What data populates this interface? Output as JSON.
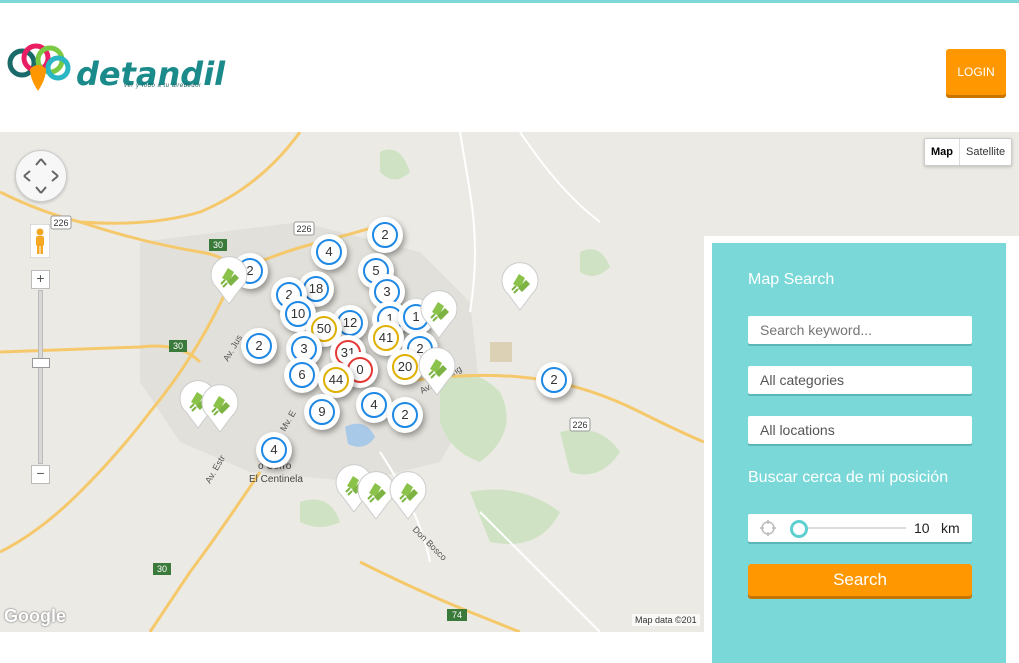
{
  "header": {
    "logo_word": "detandil",
    "logo_tagline": "ver y todo a tu alrededor",
    "login_label": "LOGIN"
  },
  "map": {
    "type_map_label": "Map",
    "type_satellite_label": "Satellite",
    "zoom_in_label": "+",
    "zoom_out_label": "−",
    "attribution_logo": "Google",
    "attribution_text": "Map data ©201",
    "road_labels": [
      "226",
      "226",
      "30",
      "30",
      "30",
      "226",
      "74"
    ],
    "street_labels": [
      "Av. Jus",
      "Av. Estr",
      "Av. Fleming",
      "Don Bosco",
      "Mv. E",
      "o Cerro",
      "El Centinela"
    ],
    "clusters": [
      "2",
      "4",
      "2",
      "5",
      "18",
      "2",
      "3",
      "10",
      "12",
      "1",
      "1",
      "50",
      "41",
      "2",
      "2",
      "3",
      "31",
      "0",
      "6",
      "44",
      "20",
      "2",
      "9",
      "4",
      "2",
      "4"
    ]
  },
  "search_panel": {
    "title": "Map Search",
    "keyword_placeholder": "Search keyword...",
    "categories_value": "All categories",
    "locations_value": "All locations",
    "near_label": "Buscar cerca de mi posición",
    "radius_value": "10",
    "radius_unit": "km",
    "radius_fraction": 0.0,
    "search_label": "Search"
  },
  "colors": {
    "accent_teal": "#7ad8d8",
    "button_orange": "#ff9800",
    "cluster_blue": "#1e88e5",
    "cluster_yellow": "#e0b000",
    "cluster_red": "#e53935"
  }
}
